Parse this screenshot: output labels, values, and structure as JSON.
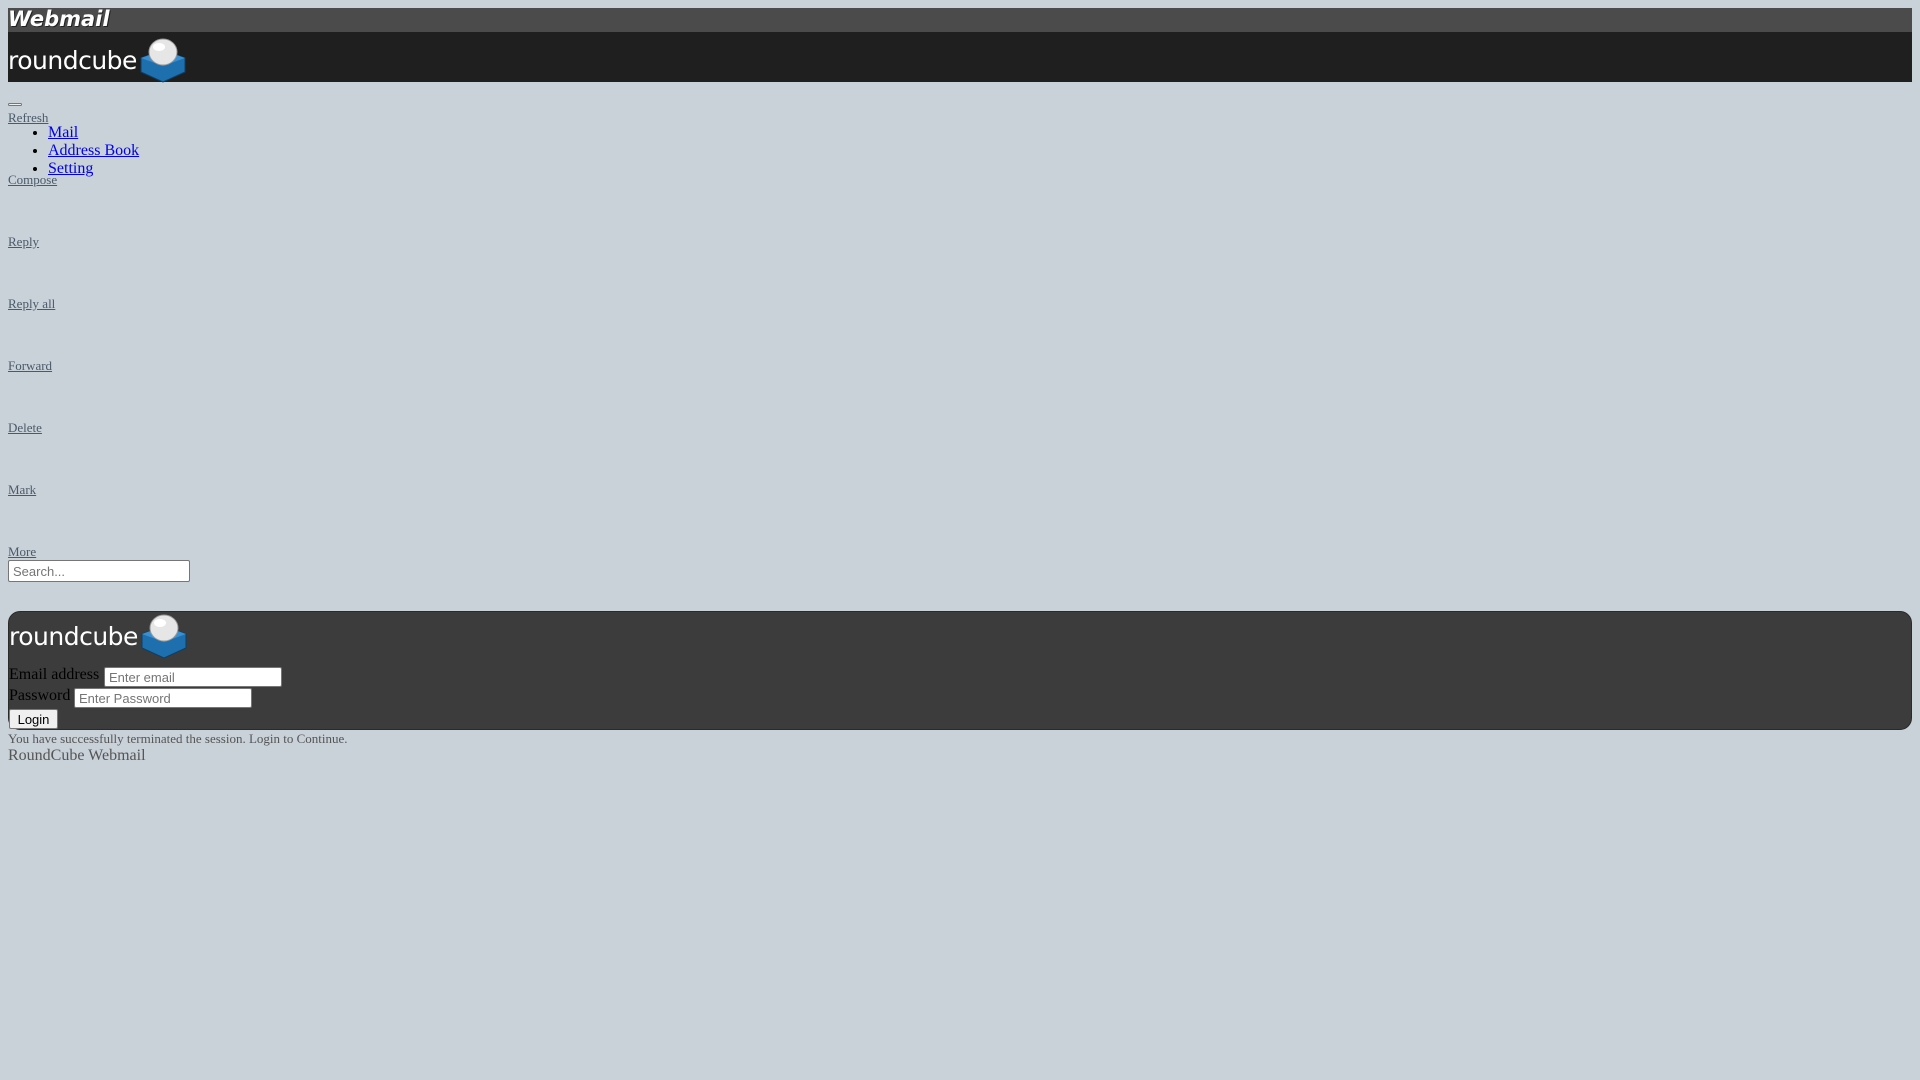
{
  "branding": {
    "webmail_logo_text": "Webmail",
    "roundcube_logo_text": "roundcube"
  },
  "toolbar": {
    "refresh": "Refresh",
    "compose": "Compose",
    "reply": "Reply",
    "reply_all": "Reply all",
    "forward": "Forward",
    "delete": "Delete",
    "mark": "Mark",
    "more": "More"
  },
  "nav": {
    "items": [
      {
        "label": "Mail"
      },
      {
        "label": "Address Book"
      },
      {
        "label": "Setting"
      }
    ]
  },
  "search": {
    "placeholder": "Search..."
  },
  "login": {
    "email_label": "Email address",
    "email_placeholder": "Enter email",
    "password_label": "Password",
    "password_placeholder": "Enter Password",
    "button_label": "Login"
  },
  "message": "You have successfully terminated the session. Login to Continue.",
  "footer": "RoundCube Webmail",
  "colors": {
    "page_background": "#c9d1d9",
    "topbar": "#4b4b4b",
    "header": "#1f1f1f",
    "login_panel": "#3c3c3c",
    "logo_accent": "#1e6fae"
  }
}
